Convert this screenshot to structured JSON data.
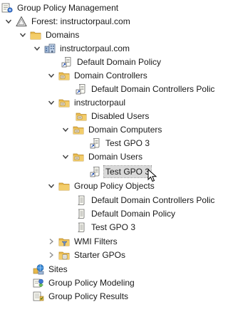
{
  "tree": {
    "root": "Group Policy Management",
    "forest": "Forest: instructorpaul.com",
    "domains": "Domains",
    "domain": "instructorpaul.com",
    "default_domain_policy_link": "Default Domain Policy",
    "domain_controllers": "Domain Controllers",
    "default_dc_policy_link": "Default Domain Controllers Polic",
    "ou_instructorpaul": "instructorpaul",
    "disabled_users": "Disabled Users",
    "domain_computers": "Domain Computers",
    "test_gpo_link_computers": "Test GPO 3",
    "domain_users": "Domain Users",
    "test_gpo_link_users": "Test GPO 3",
    "gpo_container": "Group Policy Objects",
    "gpo_default_dc_policy": "Default Domain Controllers Polic",
    "gpo_default_domain_policy": "Default Domain Policy",
    "gpo_test": "Test GPO 3",
    "wmi_filters": "WMI Filters",
    "starter_gpos": "Starter GPOs",
    "sites": "Sites",
    "modeling": "Group Policy Modeling",
    "results": "Group Policy Results"
  },
  "selected_item": "Test GPO 3",
  "colors": {
    "folder": "#e8b84a",
    "folder_dark": "#c9952a",
    "selection": "#d9d9d9",
    "twisty": "#404040"
  },
  "icons": {
    "root": "gpm-console-icon",
    "forest": "forest-triangle-icon",
    "domains": "folder-icon",
    "domain": "domain-building-icon",
    "gpo_link": "gpo-link-shortcut-icon",
    "ou": "ou-folder-icon",
    "gpo": "gpo-scroll-icon",
    "wmi": "wmi-filter-folder-icon",
    "starter": "starter-gpo-folder-icon",
    "sites": "sites-icon",
    "modeling": "modeling-icon",
    "results": "results-icon"
  }
}
